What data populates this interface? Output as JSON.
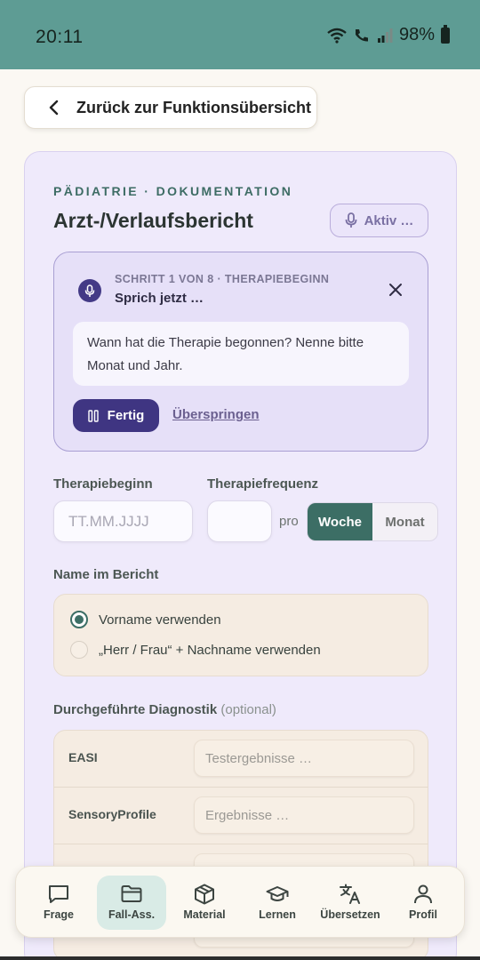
{
  "status_bar": {
    "time": "20:11",
    "battery": "98%"
  },
  "back_button": {
    "label": "Zurück zur Funktionsübersicht"
  },
  "card": {
    "overline": "PÄDIATRIE · DOKUMENTATION",
    "title": "Arzt-/Verlaufsbericht",
    "voice_toggle_label": "Aktiv …"
  },
  "step_panel": {
    "overline": "SCHRITT 1 VON 8 · THERAPIEBEGINN",
    "title": "Sprich jetzt …",
    "prompt": "Wann hat die Therapie begonnen? Nenne bitte Monat und Jahr.",
    "done_label": "Fertig",
    "skip_label": "Überspringen"
  },
  "form": {
    "start_label": "Therapiebeginn",
    "start_placeholder": "TT.MM.JJJJ",
    "frequency_label": "Therapiefrequenz",
    "frequency_value": "",
    "per_label": "pro",
    "period_options": [
      "Woche",
      "Monat"
    ],
    "period_selected": "Woche",
    "name_label": "Name im Bericht",
    "name_options": [
      "Vorname verwenden",
      "„Herr / Frau“ + Nachname verwenden"
    ],
    "name_selected": 0,
    "diagnostics_label": "Durchgeführte Diagnostik",
    "diagnostics_optional": "(optional)",
    "diagnostics_rows": [
      {
        "name": "EASI",
        "placeholder": "Testergebnisse …"
      },
      {
        "name": "SensoryProfile",
        "placeholder": "Ergebnisse …"
      }
    ]
  },
  "nav": {
    "items": [
      {
        "label": "Frage",
        "icon": "chat-bubble-icon"
      },
      {
        "label": "Fall-Ass.",
        "icon": "folder-icon"
      },
      {
        "label": "Material",
        "icon": "cube-icon"
      },
      {
        "label": "Lernen",
        "icon": "graduation-cap-icon"
      },
      {
        "label": "Übersetzen",
        "icon": "translate-icon"
      },
      {
        "label": "Profil",
        "icon": "person-icon"
      }
    ],
    "active": "Fall-Ass."
  },
  "colors": {
    "status_bar": "#5e9c94",
    "accent_green": "#3c6e65",
    "accent_purple": "#3f3582",
    "card_bg": "#efeafb"
  }
}
